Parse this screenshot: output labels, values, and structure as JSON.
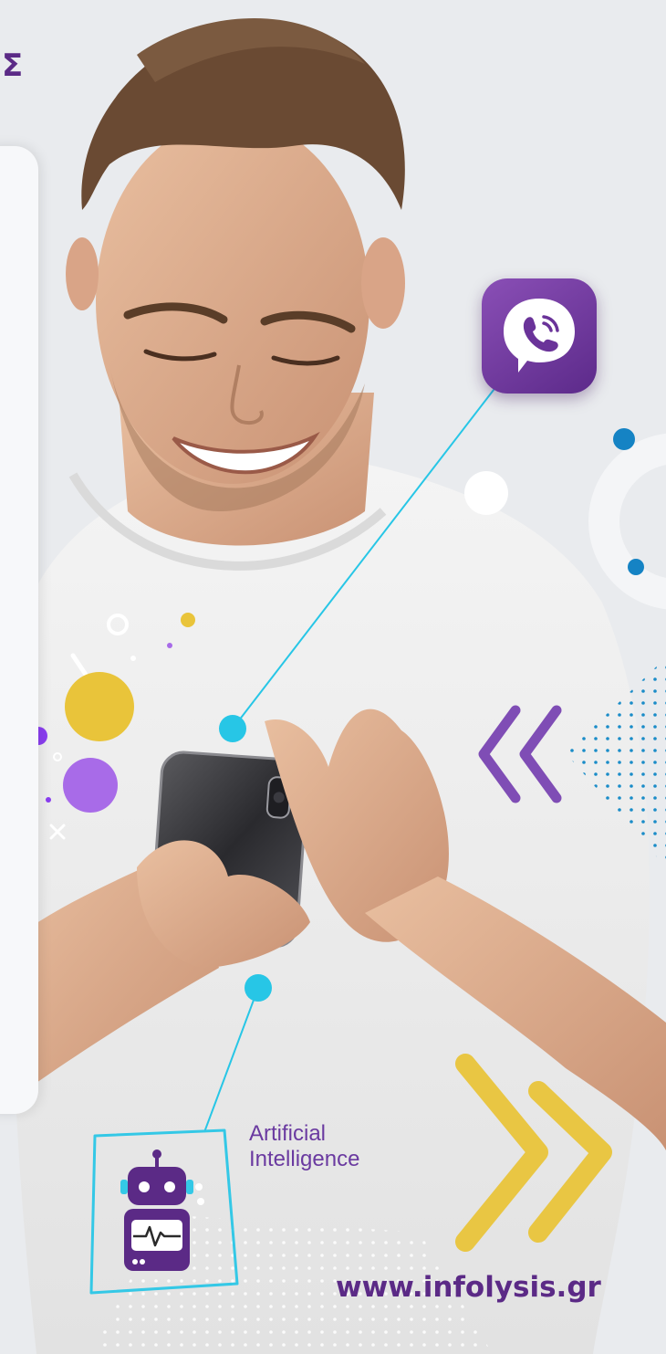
{
  "colors": {
    "brand_purple": "#5b2a86",
    "label_purple": "#6a3aa0",
    "cyan": "#27c6e6",
    "blue_dot": "#1583c4",
    "yellow": "#e9c43a",
    "violet": "#a86be8"
  },
  "top_left_fragment": "Σ",
  "viber": {
    "icon": "viber-phone-icon"
  },
  "ai": {
    "line1": "Artificial",
    "line2": "Intelligence",
    "icon": "robot-icon"
  },
  "website": "www.infolysis.gr"
}
